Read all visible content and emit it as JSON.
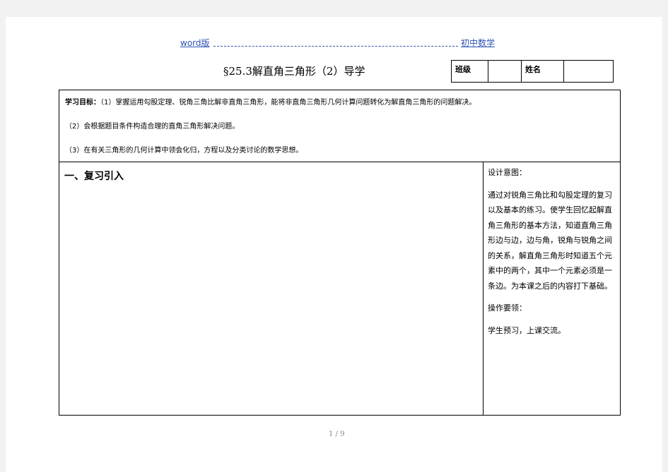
{
  "header": {
    "left_text": "word版",
    "right_text": "初中数学"
  },
  "document": {
    "title": "§25.3解直角三角形（2）导学",
    "info_table": {
      "class_label": "班级",
      "class_value": "",
      "name_label": "姓名",
      "name_value": ""
    },
    "goals": {
      "label": "学习目标：",
      "item1": "（1）掌握运用勾股定理、锐角三角比解非直角三角形，能将非直角三角形几何计算问题转化为解直角三角形的问题解决。",
      "item2": "（2）会根据题目条件构造合理的直角三角形解决问题。",
      "item3": "（3）在有关三角形的几何计算中领会化归，方程以及分类讨论的数学思想。"
    },
    "section": {
      "heading": "一、复习引入"
    },
    "sidebar": {
      "purpose_label": "设计意图：",
      "purpose_text": "通过对锐角三角比和勾股定理的复习以及基本的练习。使学生回忆起解直角三角形的基本方法，知道直角三角形边与边，边与角，锐角与锐角之间的关系，解直角三角形时知道五个元素中的两个，其中一个元素必须是一条边。为本课之后的内容打下基础。",
      "operation_label": "操作要领：",
      "operation_text": "学生预习，上课交流。"
    }
  },
  "footer": {
    "page_indicator": "1 / 9"
  }
}
